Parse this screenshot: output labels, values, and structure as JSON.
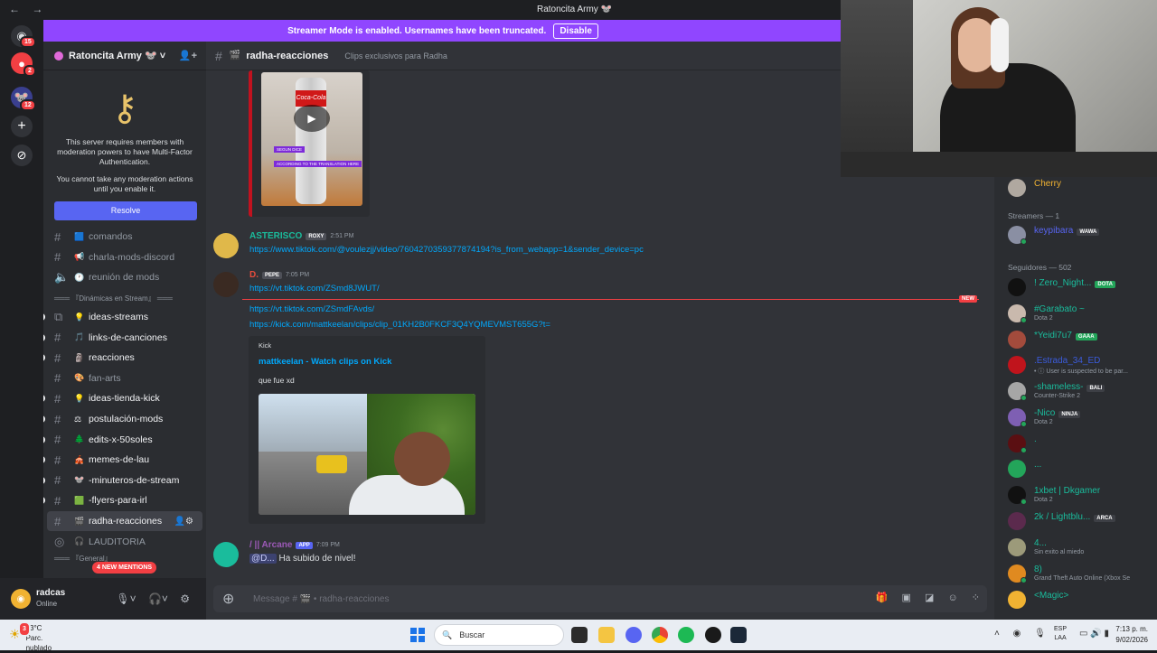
{
  "window": {
    "title": "Ratoncita Army 🐭",
    "nav_back": "←",
    "nav_forward": "→"
  },
  "banner": {
    "text": "Streamer Mode is enabled. Usernames have been truncated.",
    "button": "Disable"
  },
  "guild_badges": [
    "15",
    "2",
    "12"
  ],
  "server": {
    "name": "Ratoncita Army 🐭 ˅",
    "mfa_text_1": "This server requires members with moderation powers to have Multi-Factor Authentication.",
    "mfa_text_2": "You cannot take any moderation actions until you enable it.",
    "resolve": "Resolve"
  },
  "channels": [
    {
      "name": "comandos",
      "emoji": "🟦"
    },
    {
      "name": "charla-mods-discord",
      "emoji": "📢"
    },
    {
      "name": "reunión de mods",
      "emoji": "🕐"
    },
    {
      "name": "ideas-streams",
      "emoji": "💡"
    },
    {
      "name": "links-de-canciones",
      "emoji": "🎵"
    },
    {
      "name": "reacciones",
      "emoji": "🗿"
    },
    {
      "name": "fan-arts",
      "emoji": "🎨"
    },
    {
      "name": "ideas-tienda-kick",
      "emoji": "💡"
    },
    {
      "name": "postulación-mods",
      "emoji": "⚖"
    },
    {
      "name": "edits-x-50soles",
      "emoji": "🌲"
    },
    {
      "name": "memes-de-lau",
      "emoji": "🎪"
    },
    {
      "name": "-minuteros-de-stream",
      "emoji": "🐭"
    },
    {
      "name": "-flyers-para-irl",
      "emoji": "🟩"
    },
    {
      "name": "radha-reacciones",
      "emoji": "🎬"
    },
    {
      "name": "LAUDITORIA",
      "emoji": "🎧"
    }
  ],
  "category_dinamicas": "═══ 『Dinámicas en Stream』 ═══",
  "category_general": "═══ 『General』",
  "mentions_pill": "4 NEW MENTIONS",
  "user": {
    "name": "radcas",
    "status": "Online"
  },
  "chat": {
    "channel": "radha-reacciones",
    "topic": "Clips exclusivos para Radha",
    "video_caption_1": "SEGUN DICE",
    "video_caption_2": "ACCORDING TO THE TRANSLATION HERE",
    "bottle_label": "Coca-Cola",
    "messages": [
      {
        "author": "ASTERISCO",
        "tag": "ROXY",
        "time": "2:51 PM",
        "link": "https://www.tiktok.com/@voulezjj/video/7604270359377874194?is_from_webapp=1&sender_device=pc"
      },
      {
        "author": "D.",
        "tag": "PEPE",
        "time": "7:05 PM",
        "link": "https://vt.tiktok.com/ZSmd8JWUT/"
      },
      {
        "link2": "https://vt.tiktok.com/ZSmdFAvds/",
        "link3": "https://kick.com/mattkeelan/clips/clip_01KH2B0FKCF3Q4YQMEVMST655G?t="
      },
      {
        "author": "/ || Arcane",
        "tag": "APP",
        "time": "7:09 PM",
        "mention": "@D...",
        "text": "Ha subido de nivel!"
      }
    ],
    "new_tag": "NEW",
    "embed": {
      "provider": "Kick",
      "title": "mattkeelan - Watch clips on Kick",
      "description": "que fue xd"
    },
    "composer_placeholder": "Message # 🎬 • radha-reacciones"
  },
  "members": [
    {
      "name": "Cherry",
      "sub": "",
      "color": "#f0b232"
    },
    {
      "name": "keypibara",
      "sub": "",
      "tag": "WAWA",
      "color": "#5865f2"
    },
    {
      "name": "! Zero_Night...",
      "sub": "",
      "tag": "DOTA",
      "color": "#1abc9c"
    },
    {
      "name": "#Garabato ~",
      "sub": "Dota 2",
      "color": "#1abc9c"
    },
    {
      "name": "*Yeidi7u7",
      "sub": "",
      "tag": "GAAA",
      "color": "#1abc9c"
    },
    {
      "name": ".Estrada_34_ED",
      "sub": "• ⓘ User is suspected to be par...",
      "color": "#3b5bdb"
    },
    {
      "name": "-shameless-",
      "sub": "Counter-Strike 2",
      "tag": "BALI",
      "color": "#1abc9c"
    },
    {
      "name": "-Nico",
      "sub": "Dota 2",
      "tag": "NINJA",
      "color": "#1abc9c"
    },
    {
      "name": ".",
      "sub": "",
      "color": "#1abc9c"
    },
    {
      "name": "...",
      "sub": "",
      "color": "#1abc9c"
    },
    {
      "name": "1xbet | Dkgamer",
      "sub": "Dota 2",
      "color": "#1abc9c"
    },
    {
      "name": "2k / Lightblu...",
      "sub": "",
      "tag": "ARCA",
      "color": "#1abc9c"
    },
    {
      "name": "4...",
      "sub": "Sin exito al miedo",
      "color": "#1abc9c"
    },
    {
      "name": "8)",
      "sub": "Grand Theft Auto Online (Xbox Se",
      "color": "#1abc9c"
    },
    {
      "name": "<Magic>",
      "sub": "",
      "color": "#1abc9c"
    }
  ],
  "member_categories": {
    "streamers": "Streamers — 1",
    "seguidores": "Seguidores — 502"
  },
  "taskbar": {
    "temp": "23°C",
    "weather": "Parc. nublado",
    "weather_badge": "3",
    "search": "Buscar",
    "lang1": "ESP",
    "lang2": "LAA",
    "time": "7:13 p. m.",
    "date": "9/02/2026"
  }
}
